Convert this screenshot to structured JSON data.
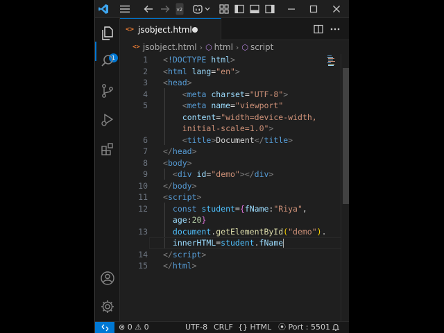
{
  "tab": {
    "label": "jsobject.html",
    "icon": "html-file-icon",
    "dirty": true
  },
  "breadcrumb": [
    "jsobject.html",
    "html",
    "script"
  ],
  "explorer_badge": "1",
  "code_lines": [
    {
      "num": "1",
      "segments": [
        [
          "t-ang",
          "<"
        ],
        [
          "t-tag",
          "!DOCTYPE"
        ],
        [
          "t-text",
          " "
        ],
        [
          "t-attr",
          "html"
        ],
        [
          "t-ang",
          ">"
        ]
      ]
    },
    {
      "num": "2",
      "segments": [
        [
          "t-ang",
          "<"
        ],
        [
          "t-tag",
          "html"
        ],
        [
          "t-text",
          " "
        ],
        [
          "t-attr",
          "lang"
        ],
        [
          "t-text",
          "="
        ],
        [
          "t-str",
          "\"en\""
        ],
        [
          "t-ang",
          ">"
        ]
      ]
    },
    {
      "num": "3",
      "segments": [
        [
          "t-ang",
          "<"
        ],
        [
          "t-tag",
          "head"
        ],
        [
          "t-ang",
          ">"
        ]
      ]
    },
    {
      "num": "4",
      "indent": 2,
      "segments": [
        [
          "t-ang",
          "<"
        ],
        [
          "t-tag",
          "meta"
        ],
        [
          "t-text",
          " "
        ],
        [
          "t-attr",
          "charset"
        ],
        [
          "t-text",
          "="
        ],
        [
          "t-str",
          "\"UTF-8\""
        ],
        [
          "t-ang",
          ">"
        ]
      ]
    },
    {
      "num": "5",
      "indent": 2,
      "segments": [
        [
          "t-ang",
          "<"
        ],
        [
          "t-tag",
          "meta"
        ],
        [
          "t-text",
          " "
        ],
        [
          "t-attr",
          "name"
        ],
        [
          "t-text",
          "="
        ],
        [
          "t-str",
          "\"viewport\""
        ]
      ]
    },
    {
      "num": "",
      "indent": 2,
      "segments": [
        [
          "t-attr",
          "content"
        ],
        [
          "t-text",
          "="
        ],
        [
          "t-str",
          "\"width=device-width,"
        ]
      ]
    },
    {
      "num": "",
      "indent": 2,
      "segments": [
        [
          "t-str",
          "initial-scale=1.0\""
        ],
        [
          "t-ang",
          ">"
        ]
      ]
    },
    {
      "num": "6",
      "indent": 2,
      "segments": [
        [
          "t-ang",
          "<"
        ],
        [
          "t-tag",
          "title"
        ],
        [
          "t-ang",
          ">"
        ],
        [
          "t-text",
          "Document"
        ],
        [
          "t-ang",
          "</"
        ],
        [
          "t-tag",
          "title"
        ],
        [
          "t-ang",
          ">"
        ]
      ]
    },
    {
      "num": "7",
      "segments": [
        [
          "t-ang",
          "</"
        ],
        [
          "t-tag",
          "head"
        ],
        [
          "t-ang",
          ">"
        ]
      ]
    },
    {
      "num": "8",
      "segments": [
        [
          "t-ang",
          "<"
        ],
        [
          "t-tag",
          "body"
        ],
        [
          "t-ang",
          ">"
        ]
      ]
    },
    {
      "num": "9",
      "indent": 1,
      "segments": [
        [
          "t-ang",
          "<"
        ],
        [
          "t-tag",
          "div"
        ],
        [
          "t-text",
          " "
        ],
        [
          "t-attr",
          "id"
        ],
        [
          "t-text",
          "="
        ],
        [
          "t-str",
          "\"demo\""
        ],
        [
          "t-ang",
          "></"
        ],
        [
          "t-tag",
          "div"
        ],
        [
          "t-ang",
          ">"
        ]
      ]
    },
    {
      "num": "10",
      "segments": [
        [
          "t-ang",
          "</"
        ],
        [
          "t-tag",
          "body"
        ],
        [
          "t-ang",
          ">"
        ]
      ]
    },
    {
      "num": "11",
      "segments": [
        [
          "t-ang",
          "<"
        ],
        [
          "t-tag",
          "script"
        ],
        [
          "t-ang",
          ">"
        ]
      ]
    },
    {
      "num": "12",
      "indent": 1,
      "segments": [
        [
          "t-kw",
          "const"
        ],
        [
          "t-text",
          " "
        ],
        [
          "t-var",
          "student"
        ],
        [
          "t-text",
          "="
        ],
        [
          "t-brace",
          "{"
        ],
        [
          "t-prop",
          "fName"
        ],
        [
          "t-text",
          ":"
        ],
        [
          "t-str",
          "\"Riya\""
        ],
        [
          "t-text",
          ","
        ]
      ]
    },
    {
      "num": "",
      "indent": 1,
      "segments": [
        [
          "t-prop",
          "age"
        ],
        [
          "t-text",
          ":"
        ],
        [
          "t-num",
          "20"
        ],
        [
          "t-brace",
          "}"
        ]
      ]
    },
    {
      "num": "13",
      "indent": 1,
      "segments": [
        [
          "t-var",
          "document"
        ],
        [
          "t-text",
          "."
        ],
        [
          "t-fn",
          "getElementById"
        ],
        [
          "t-paren",
          "("
        ],
        [
          "t-str",
          "\"demo\""
        ],
        [
          "t-paren",
          ")"
        ],
        [
          "t-text",
          "."
        ]
      ]
    },
    {
      "num": "",
      "indent": 1,
      "cursor": true,
      "segments": [
        [
          "t-prop",
          "innerHTML"
        ],
        [
          "t-text",
          "="
        ],
        [
          "t-var",
          "student"
        ],
        [
          "t-text",
          "."
        ],
        [
          "t-prop",
          "fName"
        ]
      ]
    },
    {
      "num": "14",
      "segments": [
        [
          "t-ang",
          "</"
        ],
        [
          "t-tag",
          "script"
        ],
        [
          "t-ang",
          ">"
        ]
      ]
    },
    {
      "num": "15",
      "segments": [
        [
          "t-ang",
          "</"
        ],
        [
          "t-tag",
          "html"
        ],
        [
          "t-ang",
          ">"
        ]
      ]
    }
  ],
  "status": {
    "remote_icon": "remote-icon",
    "errors": "0",
    "warnings": "0",
    "encoding": "UTF-8",
    "eol": "CRLF",
    "language": "HTML",
    "language_prefix": "{}",
    "port": "Port : 5501"
  }
}
